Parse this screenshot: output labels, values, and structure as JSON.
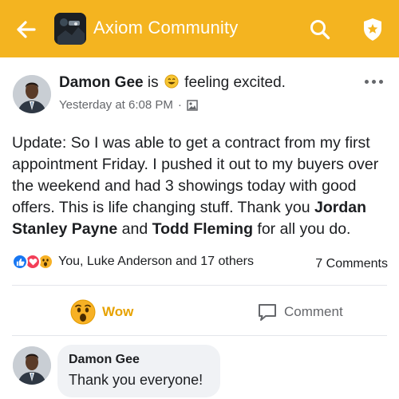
{
  "header": {
    "title": "Axiom Community",
    "back_icon": "arrow-left-icon",
    "search_icon": "search-icon",
    "shield_icon": "shield-star-icon",
    "bg_color": "#f4b420"
  },
  "post": {
    "author": "Damon Gee",
    "is_text": "is",
    "feeling": "feeling excited.",
    "timestamp": "Yesterday at 6:08 PM",
    "meta_separator": "·",
    "body_parts": {
      "intro": "Update: So I was able to get a contract from my first appointment Friday. I pushed it out to my buyers over the weekend and had 3 showings today with good offers. This is life changing stuff. Thank you ",
      "mention1": "Jordan Stanley Payne",
      "and": " and ",
      "mention2": "Todd Fleming",
      "outro": " for all you do."
    },
    "reactions_text": "You, Luke Anderson and 17 others",
    "comments_count": "7 Comments",
    "actions": {
      "wow_label": "Wow",
      "comment_label": "Comment"
    }
  },
  "comment": {
    "author": "Damon Gee",
    "text": "Thank you everyone!"
  },
  "colors": {
    "accent": "#f4b420",
    "like_blue": "#1877f2",
    "love_red": "#f33e58",
    "wow_yellow": "#f7b125",
    "wow_text": "#e7a200"
  }
}
